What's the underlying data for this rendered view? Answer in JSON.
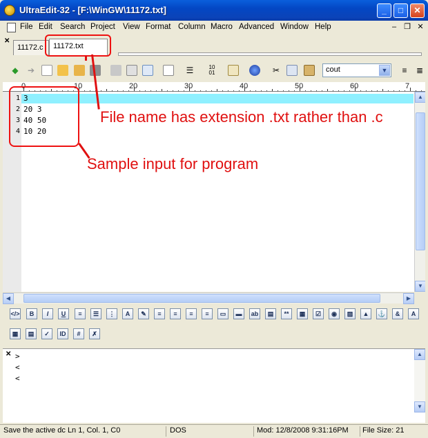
{
  "window": {
    "title": "UltraEdit-32 - [F:\\WinGW\\11172.txt]"
  },
  "menu": [
    "File",
    "Edit",
    "Search",
    "Project",
    "View",
    "Format",
    "Column",
    "Macro",
    "Advanced",
    "Window",
    "Help"
  ],
  "tabs": [
    {
      "label": "11172.c"
    },
    {
      "label": "11172.txt"
    }
  ],
  "toolbar": {
    "combo_value": "cout"
  },
  "ruler": [
    "0",
    "10",
    "20",
    "30",
    "40",
    "50",
    "60",
    "7"
  ],
  "editor": {
    "lines": [
      {
        "num": "1",
        "text": "3"
      },
      {
        "num": "2",
        "text": "20 3"
      },
      {
        "num": "3",
        "text": "40 50"
      },
      {
        "num": "4",
        "text": "10 20"
      }
    ]
  },
  "annotations": {
    "filename": "File name has extension .txt rather than .c",
    "sample": "Sample input for program"
  },
  "output": {
    "lines": [
      ">",
      "<",
      "<"
    ]
  },
  "status": {
    "help": "Save the active dc Ln 1, Col. 1, C0",
    "format": "DOS",
    "modified": "Mod: 12/8/2008 9:31:16PM",
    "file_size": "File Size: 21"
  },
  "colors": {
    "annotation": "#e01010",
    "active_line": "#8ff0ff",
    "title_bar": "#0347c4"
  }
}
